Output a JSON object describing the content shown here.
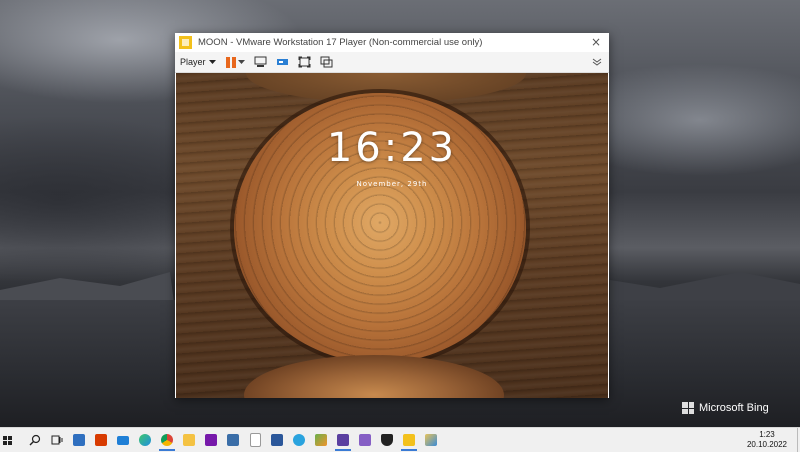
{
  "vm_window": {
    "title": "MOON - VMware Workstation 17 Player (Non-commercial use only)",
    "close_glyph": "×",
    "player_menu_label": "Player",
    "toolbar_icons": [
      "pause-icon",
      "send-ctrl-alt-del-icon",
      "devices-icon",
      "fullscreen-icon",
      "unity-icon",
      "collapse-icon"
    ]
  },
  "guest_lock_screen": {
    "time": "16:23",
    "date": "November, 29th"
  },
  "desktop": {
    "watermark": "Microsoft Bing"
  },
  "taskbar": {
    "start_label": "Start",
    "pinned": [
      "Search",
      "Task View",
      "Calculator",
      "Office",
      "Mail",
      "Edge",
      "Chrome",
      "File Explorer",
      "OneNote",
      "Phone Link",
      "Notepad",
      "Word",
      "Telegram",
      "Paint",
      "Floppy",
      "Visual Studio",
      "Security",
      "Folder",
      "Paint Tool"
    ],
    "tray_time": "1:23",
    "tray_date": "20.10.2022"
  },
  "colors": {
    "accent": "#3a7bd5",
    "vmware_yellow": "#f3c11c",
    "pause_orange": "#e8671c"
  }
}
